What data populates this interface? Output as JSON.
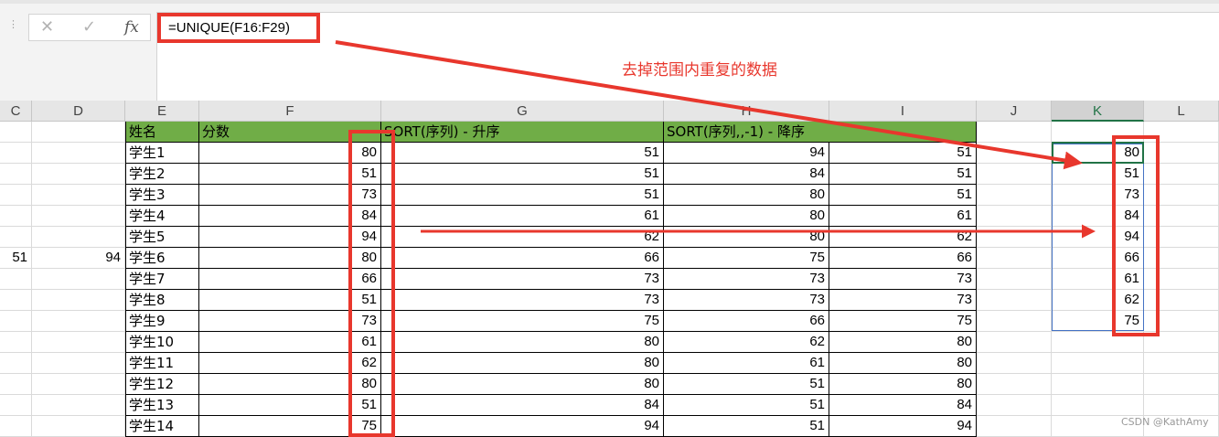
{
  "formula_bar": {
    "cancel_glyph": "✕",
    "enter_glyph": "✓",
    "fx_label": "fx",
    "formula": "=UNIQUE(F16:F29)"
  },
  "annotation": "去掉范围内重复的数据",
  "columns": [
    "C",
    "D",
    "E",
    "F",
    "G",
    "H",
    "I",
    "J",
    "K",
    "L"
  ],
  "selected_column": "K",
  "table_headers": {
    "name": "姓名",
    "score": "分数",
    "sort_asc": "SORT(序列)  -  升序",
    "sort_desc": "SORT(序列,,-1)  -  降序"
  },
  "rows": [
    {
      "name": "学生1",
      "score": "80",
      "g": "51",
      "h": "94",
      "i": "51",
      "c": "",
      "d": ""
    },
    {
      "name": "学生2",
      "score": "51",
      "g": "51",
      "h": "84",
      "i": "51",
      "c": "",
      "d": ""
    },
    {
      "name": "学生3",
      "score": "73",
      "g": "51",
      "h": "80",
      "i": "51",
      "c": "",
      "d": ""
    },
    {
      "name": "学生4",
      "score": "84",
      "g": "61",
      "h": "80",
      "i": "61",
      "c": "",
      "d": ""
    },
    {
      "name": "学生5",
      "score": "94",
      "g": "62",
      "h": "80",
      "i": "62",
      "c": "",
      "d": ""
    },
    {
      "name": "学生6",
      "score": "80",
      "g": "66",
      "h": "75",
      "i": "66",
      "c": "51",
      "d": "94"
    },
    {
      "name": "学生7",
      "score": "66",
      "g": "73",
      "h": "73",
      "i": "73",
      "c": "",
      "d": ""
    },
    {
      "name": "学生8",
      "score": "51",
      "g": "73",
      "h": "73",
      "i": "73",
      "c": "",
      "d": ""
    },
    {
      "name": "学生9",
      "score": "73",
      "g": "75",
      "h": "66",
      "i": "75",
      "c": "",
      "d": ""
    },
    {
      "name": "学生10",
      "score": "61",
      "g": "80",
      "h": "62",
      "i": "80",
      "c": "",
      "d": ""
    },
    {
      "name": "学生11",
      "score": "62",
      "g": "80",
      "h": "61",
      "i": "80",
      "c": "",
      "d": ""
    },
    {
      "name": "学生12",
      "score": "80",
      "g": "80",
      "h": "51",
      "i": "80",
      "c": "",
      "d": ""
    },
    {
      "name": "学生13",
      "score": "51",
      "g": "84",
      "h": "51",
      "i": "84",
      "c": "",
      "d": ""
    },
    {
      "name": "学生14",
      "score": "75",
      "g": "94",
      "h": "51",
      "i": "94",
      "c": "",
      "d": ""
    }
  ],
  "unique_values": [
    "80",
    "51",
    "73",
    "84",
    "94",
    "66",
    "61",
    "62",
    "75"
  ],
  "watermark": "CSDN @KathAmy",
  "colors": {
    "header_fill": "#70ad47",
    "accent": "#217346",
    "highlight": "#e8372d",
    "selection": "#4472c4"
  }
}
